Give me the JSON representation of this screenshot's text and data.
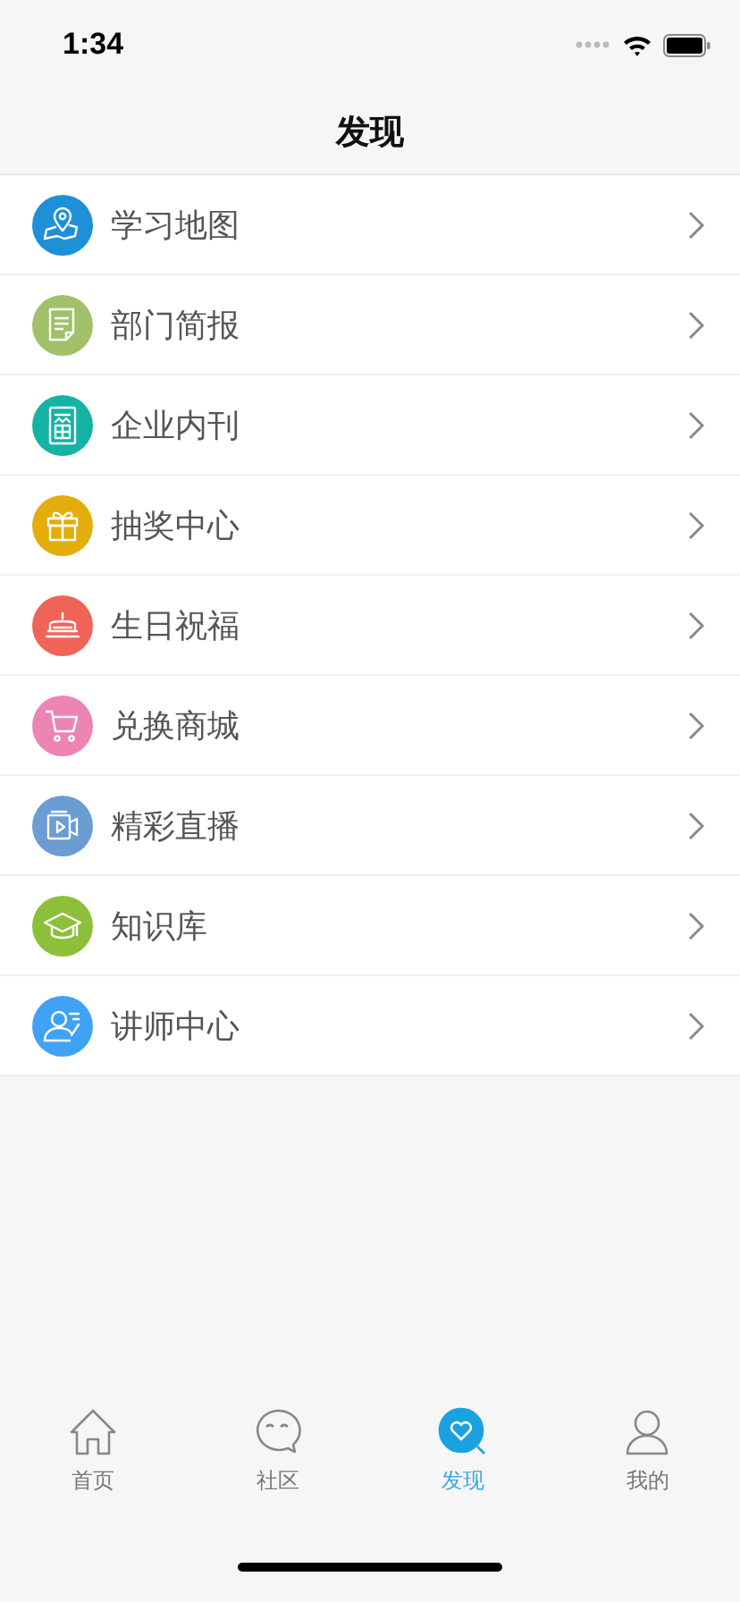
{
  "status_bar": {
    "time": "1:34"
  },
  "nav": {
    "title": "发现"
  },
  "items": [
    {
      "label": "学习地图",
      "kind": "map",
      "color": "#1e90d8"
    },
    {
      "label": "部门简报",
      "kind": "doc",
      "color": "#a0c06a"
    },
    {
      "label": "企业内刊",
      "kind": "journal",
      "color": "#14b3a4"
    },
    {
      "label": "抽奖中心",
      "kind": "gift",
      "color": "#e3ad0c"
    },
    {
      "label": "生日祝福",
      "kind": "cake",
      "color": "#f06458"
    },
    {
      "label": "兑换商城",
      "kind": "cart",
      "color": "#ec84b4"
    },
    {
      "label": "精彩直播",
      "kind": "video",
      "color": "#6b9cd2"
    },
    {
      "label": "知识库",
      "kind": "cap",
      "color": "#8cc03a"
    },
    {
      "label": "讲师中心",
      "kind": "teacher",
      "color": "#40a2f4"
    }
  ],
  "tabs": [
    {
      "label": "首页",
      "kind": "home",
      "selected": false
    },
    {
      "label": "社区",
      "kind": "chat",
      "selected": false
    },
    {
      "label": "发现",
      "kind": "discover",
      "selected": true
    },
    {
      "label": "我的",
      "kind": "user",
      "selected": false
    }
  ]
}
